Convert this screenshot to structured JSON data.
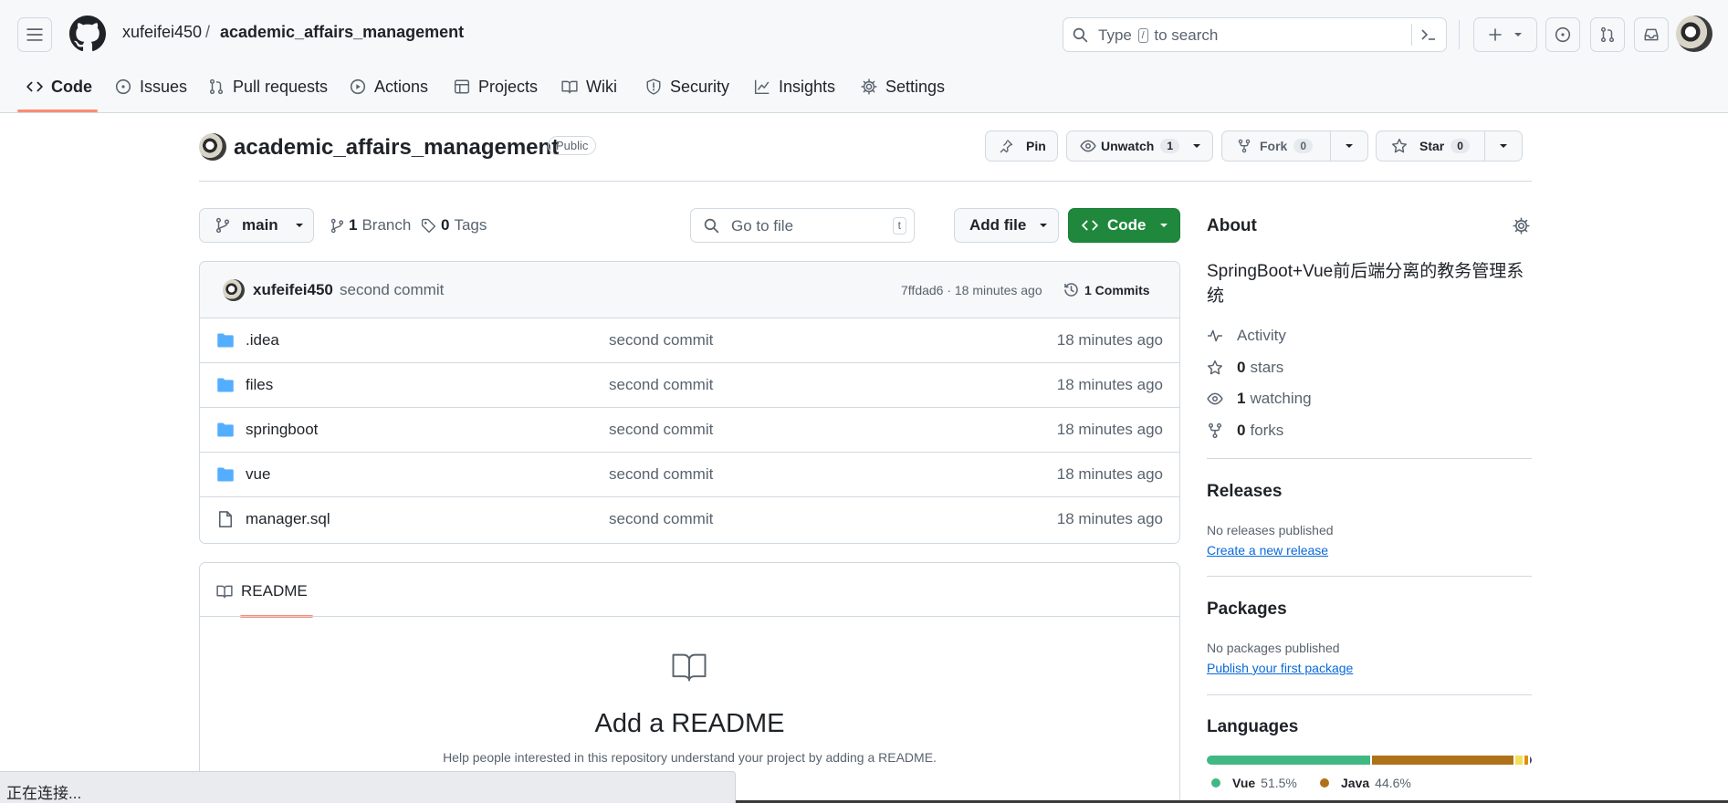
{
  "header": {
    "owner": "xufeifei450",
    "separator": "/",
    "repo": "academic_affairs_management",
    "search": {
      "before": "Type",
      "key": "/",
      "after": "to search"
    }
  },
  "tabs": [
    {
      "label": "Code",
      "icon": "code-icon",
      "active": true
    },
    {
      "label": "Issues",
      "icon": "issue-icon"
    },
    {
      "label": "Pull requests",
      "icon": "pull-request-icon"
    },
    {
      "label": "Actions",
      "icon": "play-icon"
    },
    {
      "label": "Projects",
      "icon": "table-icon"
    },
    {
      "label": "Wiki",
      "icon": "book-icon"
    },
    {
      "label": "Security",
      "icon": "shield-icon"
    },
    {
      "label": "Insights",
      "icon": "graph-icon"
    },
    {
      "label": "Settings",
      "icon": "gear-icon"
    }
  ],
  "repo_head": {
    "title": "academic_affairs_management",
    "visibility": "Public",
    "pin_label": "Pin",
    "watch_label": "Unwatch",
    "watch_count": "1",
    "fork_label": "Fork",
    "fork_count": "0",
    "star_label": "Star",
    "star_count": "0"
  },
  "toolbar": {
    "branch": "main",
    "branches_count": "1",
    "branches_label": "Branch",
    "tags_count": "0",
    "tags_label": "Tags",
    "goto_placeholder": "Go to file",
    "goto_key": "t",
    "add_file_label": "Add file",
    "code_label": "Code"
  },
  "latest_commit": {
    "author": "xufeifei450",
    "message": "second commit",
    "sha_time": "7ffdad6 · 18 minutes ago",
    "commits_label": "1 Commits"
  },
  "files": [
    {
      "type": "folder",
      "name": ".idea",
      "message": "second commit",
      "age": "18 minutes ago"
    },
    {
      "type": "folder",
      "name": "files",
      "message": "second commit",
      "age": "18 minutes ago"
    },
    {
      "type": "folder",
      "name": "springboot",
      "message": "second commit",
      "age": "18 minutes ago"
    },
    {
      "type": "folder",
      "name": "vue",
      "message": "second commit",
      "age": "18 minutes ago"
    },
    {
      "type": "file",
      "name": "manager.sql",
      "message": "second commit",
      "age": "18 minutes ago"
    }
  ],
  "readme": {
    "tab_label": "README",
    "heading": "Add a README",
    "description": "Help people interested in this repository understand your project by adding a README."
  },
  "about": {
    "heading": "About",
    "description": "SpringBoot+Vue前后端分离的教务管理系统",
    "activity": "Activity",
    "stars_count": "0",
    "stars_label": "stars",
    "watching_count": "1",
    "watching_label": "watching",
    "forks_count": "0",
    "forks_label": "forks"
  },
  "releases": {
    "heading": "Releases",
    "empty": "No releases published",
    "link": "Create a new release"
  },
  "packages": {
    "heading": "Packages",
    "empty": "No packages published",
    "link": "Publish your first package"
  },
  "languages": {
    "heading": "Languages",
    "items": [
      {
        "name": "Vue",
        "percent": "51.5%",
        "value": 51.5,
        "color": "#41b883"
      },
      {
        "name": "Java",
        "percent": "44.6%",
        "value": 44.6,
        "color": "#b07219"
      },
      {
        "value": 2.3,
        "color": "#f1e05a"
      },
      {
        "value": 1.0,
        "color": "#e38c00"
      },
      {
        "value": 0.6,
        "color": "#563d7c"
      }
    ]
  },
  "status_bar": "正在连接..."
}
